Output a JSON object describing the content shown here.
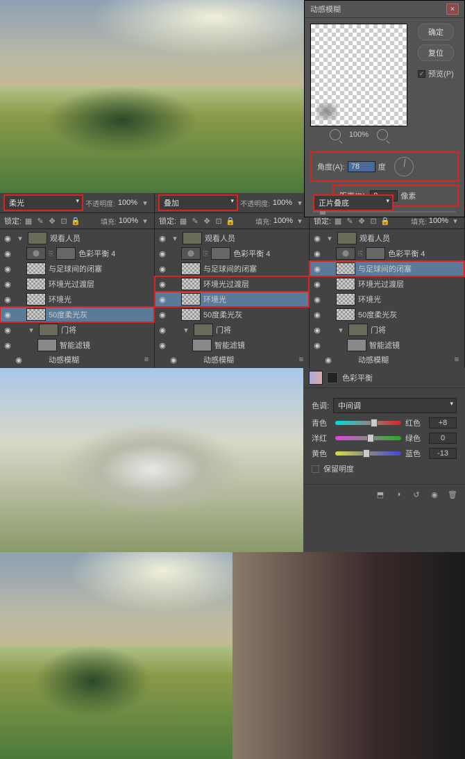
{
  "dialog": {
    "title": "动感模糊",
    "ok": "确定",
    "reset": "复位",
    "preview_chk": "预览(P)",
    "zoom": "100%",
    "angle_label": "角度(A):",
    "angle_value": "78",
    "angle_unit": "度",
    "dist_label": "距离(D):",
    "dist_value": "9",
    "dist_unit": "像素"
  },
  "blend": {
    "p0": "柔光",
    "p1": "叠加",
    "p2": "正片叠底"
  },
  "labels": {
    "opacity": "不透明度:",
    "fill": "填充:",
    "lock": "锁定:"
  },
  "pct": "100%",
  "group": "观看人员",
  "layers_common": {
    "l0": "色彩平衡 4",
    "l1": "与足球间的闭塞",
    "l2": "环境光过渡层",
    "l3": "环境光",
    "l4": "50度柔光灰",
    "folder": "门将",
    "smart": "智能滤镜",
    "mb": "动感模糊"
  },
  "cb": {
    "title": "色彩平衡",
    "tone_lbl": "色调:",
    "tone_val": "中间调",
    "cyan": "青色",
    "red": "红色",
    "v0": "+8",
    "mag": "洋红",
    "grn": "绿色",
    "v1": "0",
    "yel": "黄色",
    "blu": "蓝色",
    "v2": "-13",
    "lum": "保留明度"
  }
}
